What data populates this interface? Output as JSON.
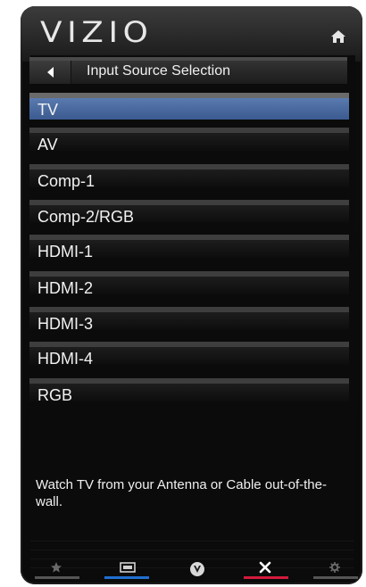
{
  "header": {
    "logo": "VIZIO",
    "home_icon": "home-icon"
  },
  "titlebar": {
    "back_icon": "back-arrow-icon",
    "title": "Input Source Selection"
  },
  "menu": {
    "items": [
      {
        "label": "TV",
        "selected": true
      },
      {
        "label": "AV",
        "selected": false
      },
      {
        "label": "Comp-1",
        "selected": false
      },
      {
        "label": "Comp-2/RGB",
        "selected": false
      },
      {
        "label": "HDMI-1",
        "selected": false
      },
      {
        "label": "HDMI-2",
        "selected": false
      },
      {
        "label": "HDMI-3",
        "selected": false
      },
      {
        "label": "HDMI-4",
        "selected": false
      },
      {
        "label": "RGB",
        "selected": false
      }
    ]
  },
  "description": "Watch TV from your Antenna or Cable out-of-the-wall.",
  "navbar": {
    "buttons": [
      {
        "icon": "star-icon",
        "color": "#555555"
      },
      {
        "icon": "screen-icon",
        "color": "#1f6fd0"
      },
      {
        "icon": "vizio-v-icon",
        "color": "#2a2a2a"
      },
      {
        "icon": "close-icon",
        "color": "#d21a3c"
      },
      {
        "icon": "gear-icon",
        "color": "#555555"
      }
    ]
  },
  "colors": {
    "selected_item": "#4a6aa0",
    "accent_blue": "#1f6fd0",
    "accent_red": "#d21a3c"
  }
}
